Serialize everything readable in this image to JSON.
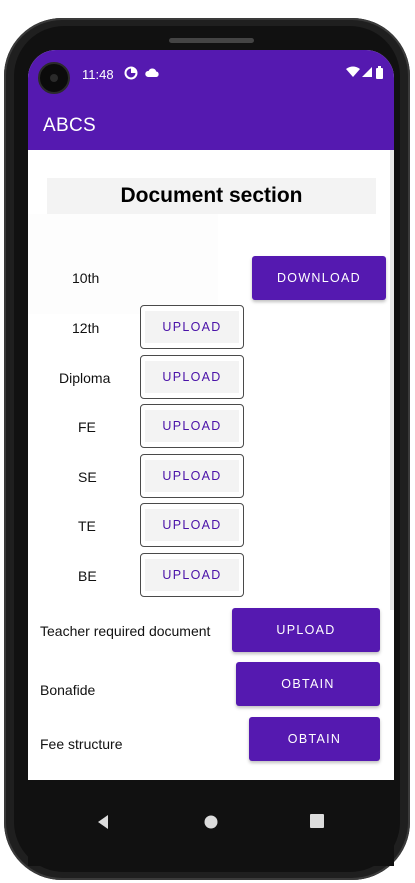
{
  "status_bar": {
    "time": "11:48",
    "icons": [
      "data-saver-icon",
      "cloud-icon",
      "wifi-icon",
      "signal-icon",
      "battery-icon"
    ]
  },
  "app_bar": {
    "title": "ABCS"
  },
  "document_section": {
    "title": "Document section",
    "rows": [
      {
        "label": "10th",
        "button": "DOWNLOAD",
        "style": "filled"
      },
      {
        "label": "12th",
        "button": "UPLOAD",
        "style": "outlined"
      },
      {
        "label": "Diploma",
        "button": "UPLOAD",
        "style": "outlined"
      },
      {
        "label": "FE",
        "button": "UPLOAD",
        "style": "outlined"
      },
      {
        "label": "SE",
        "button": "UPLOAD",
        "style": "outlined"
      },
      {
        "label": "TE",
        "button": "UPLOAD",
        "style": "outlined"
      },
      {
        "label": "BE",
        "button": "UPLOAD",
        "style": "outlined"
      },
      {
        "label": "Teacher required document",
        "button": "UPLOAD",
        "style": "filled"
      },
      {
        "label": "Bonafide",
        "button": "OBTAIN",
        "style": "filled"
      },
      {
        "label": "Fee structure",
        "button": "OBTAIN",
        "style": "filled"
      }
    ]
  },
  "nav_bar": {
    "icons": [
      "back-icon",
      "home-icon",
      "recents-icon"
    ]
  },
  "colors": {
    "primary": "#5519b0",
    "outlined_text": "#4a12a8",
    "header_bg": "#f3f3f3"
  }
}
